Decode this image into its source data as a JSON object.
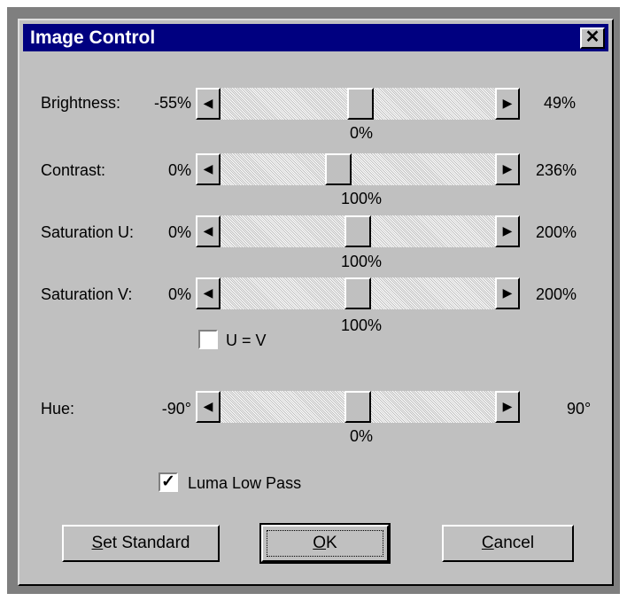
{
  "window": {
    "title": "Image Control",
    "close_glyph": "✕"
  },
  "sliders": [
    {
      "label": "Brightness:",
      "min": "-55%",
      "max": "49%",
      "current": "0%",
      "position_pct": 51
    },
    {
      "label": "Contrast:",
      "min": "0%",
      "max": "236%",
      "current": "100%",
      "position_pct": 42
    },
    {
      "label": "Saturation U:",
      "min": "0%",
      "max": "200%",
      "current": "100%",
      "position_pct": 50
    },
    {
      "label": "Saturation V:",
      "min": "0%",
      "max": "200%",
      "current": "100%",
      "position_pct": 50
    },
    {
      "label": "Hue:",
      "min": "-90°",
      "max": "90°",
      "current": "0%",
      "position_pct": 50
    }
  ],
  "checkboxes": {
    "u_eq_v": {
      "label": "U = V",
      "checked": false
    },
    "luma_low_pass": {
      "label": "Luma Low Pass",
      "checked": true
    }
  },
  "buttons": {
    "set_standard": {
      "mnemonic": "S",
      "rest": "et Standard"
    },
    "ok": {
      "mnemonic": "O",
      "rest": "K"
    },
    "cancel": {
      "mnemonic": "C",
      "rest": "ancel"
    }
  },
  "glyphs": {
    "left_arrow": "◀",
    "right_arrow": "▶",
    "check": "✓"
  }
}
